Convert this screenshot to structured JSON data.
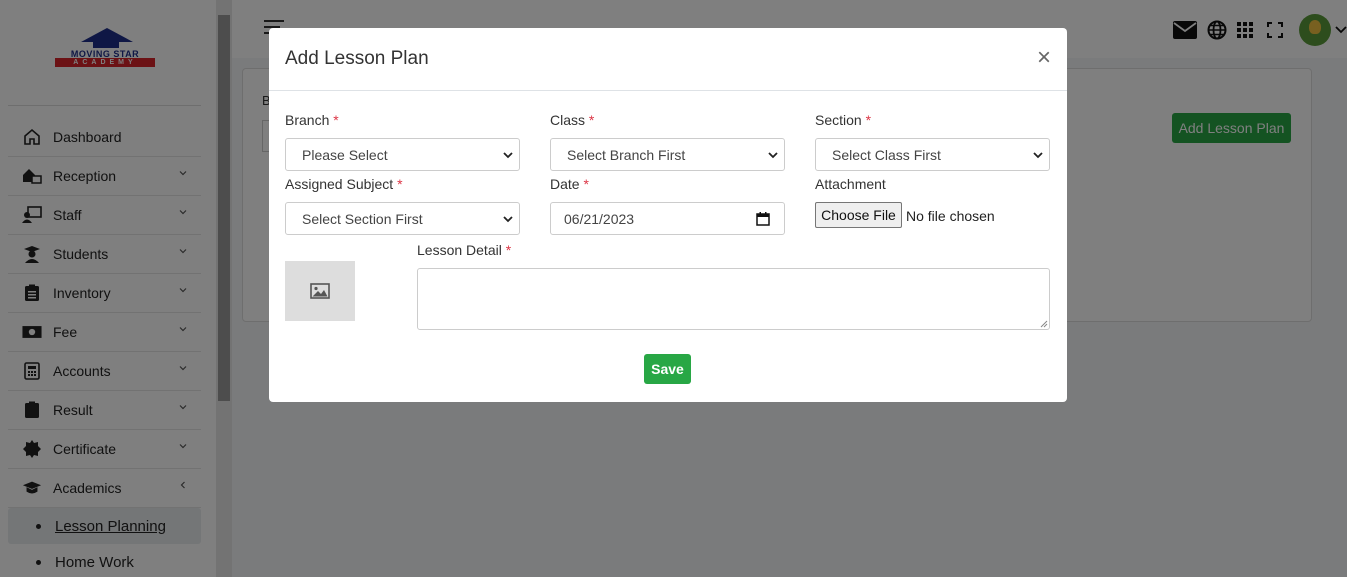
{
  "sidebar": {
    "logo": {
      "line1": "MOVING STAR",
      "line2": "ACADEMY"
    },
    "items": [
      {
        "label": "Dashboard",
        "icon": "home-icon",
        "chevron": ""
      },
      {
        "label": "Reception",
        "icon": "reception-icon",
        "chevron": "down"
      },
      {
        "label": "Staff",
        "icon": "staff-icon",
        "chevron": "down"
      },
      {
        "label": "Students",
        "icon": "student-icon",
        "chevron": "down"
      },
      {
        "label": "Inventory",
        "icon": "clipboard-icon",
        "chevron": "down"
      },
      {
        "label": "Fee",
        "icon": "money-icon",
        "chevron": "down"
      },
      {
        "label": "Accounts",
        "icon": "calculator-icon",
        "chevron": "down"
      },
      {
        "label": "Result",
        "icon": "clipboard-check-icon",
        "chevron": "down"
      },
      {
        "label": "Certificate",
        "icon": "certificate-icon",
        "chevron": "down"
      },
      {
        "label": "Academics",
        "icon": "graduation-cap-icon",
        "chevron": "left"
      }
    ],
    "sub_items": [
      {
        "label": "Lesson Planning",
        "active": true
      },
      {
        "label": "Home Work",
        "active": false
      }
    ]
  },
  "topbar": {
    "icons": [
      "envelope-icon",
      "globe-icon",
      "grid-icon",
      "fullscreen-icon",
      "avatar",
      "chevron-down-icon"
    ]
  },
  "main": {
    "filter_label_fragment": "B",
    "add_button_label": "Add Lesson Plan"
  },
  "modal": {
    "title": "Add Lesson Plan",
    "close_glyph": "×",
    "fields": {
      "branch": {
        "label": "Branch",
        "value": "Please Select"
      },
      "class": {
        "label": "Class",
        "value": "Select Branch First"
      },
      "section": {
        "label": "Section",
        "value": "Select Class First"
      },
      "subject": {
        "label": "Assigned Subject",
        "value": "Select Section First"
      },
      "date": {
        "label": "Date",
        "value": "06/21/2023"
      },
      "attachment": {
        "label": "Attachment",
        "button": "Choose File",
        "status": "No file chosen"
      },
      "detail": {
        "label": "Lesson Detail",
        "value": ""
      }
    },
    "required_mark": "*",
    "save_label": "Save"
  },
  "colors": {
    "accent_green": "#28a745",
    "required_red": "#dc3545",
    "overlay": "rgba(0,0,0,0.5)"
  }
}
